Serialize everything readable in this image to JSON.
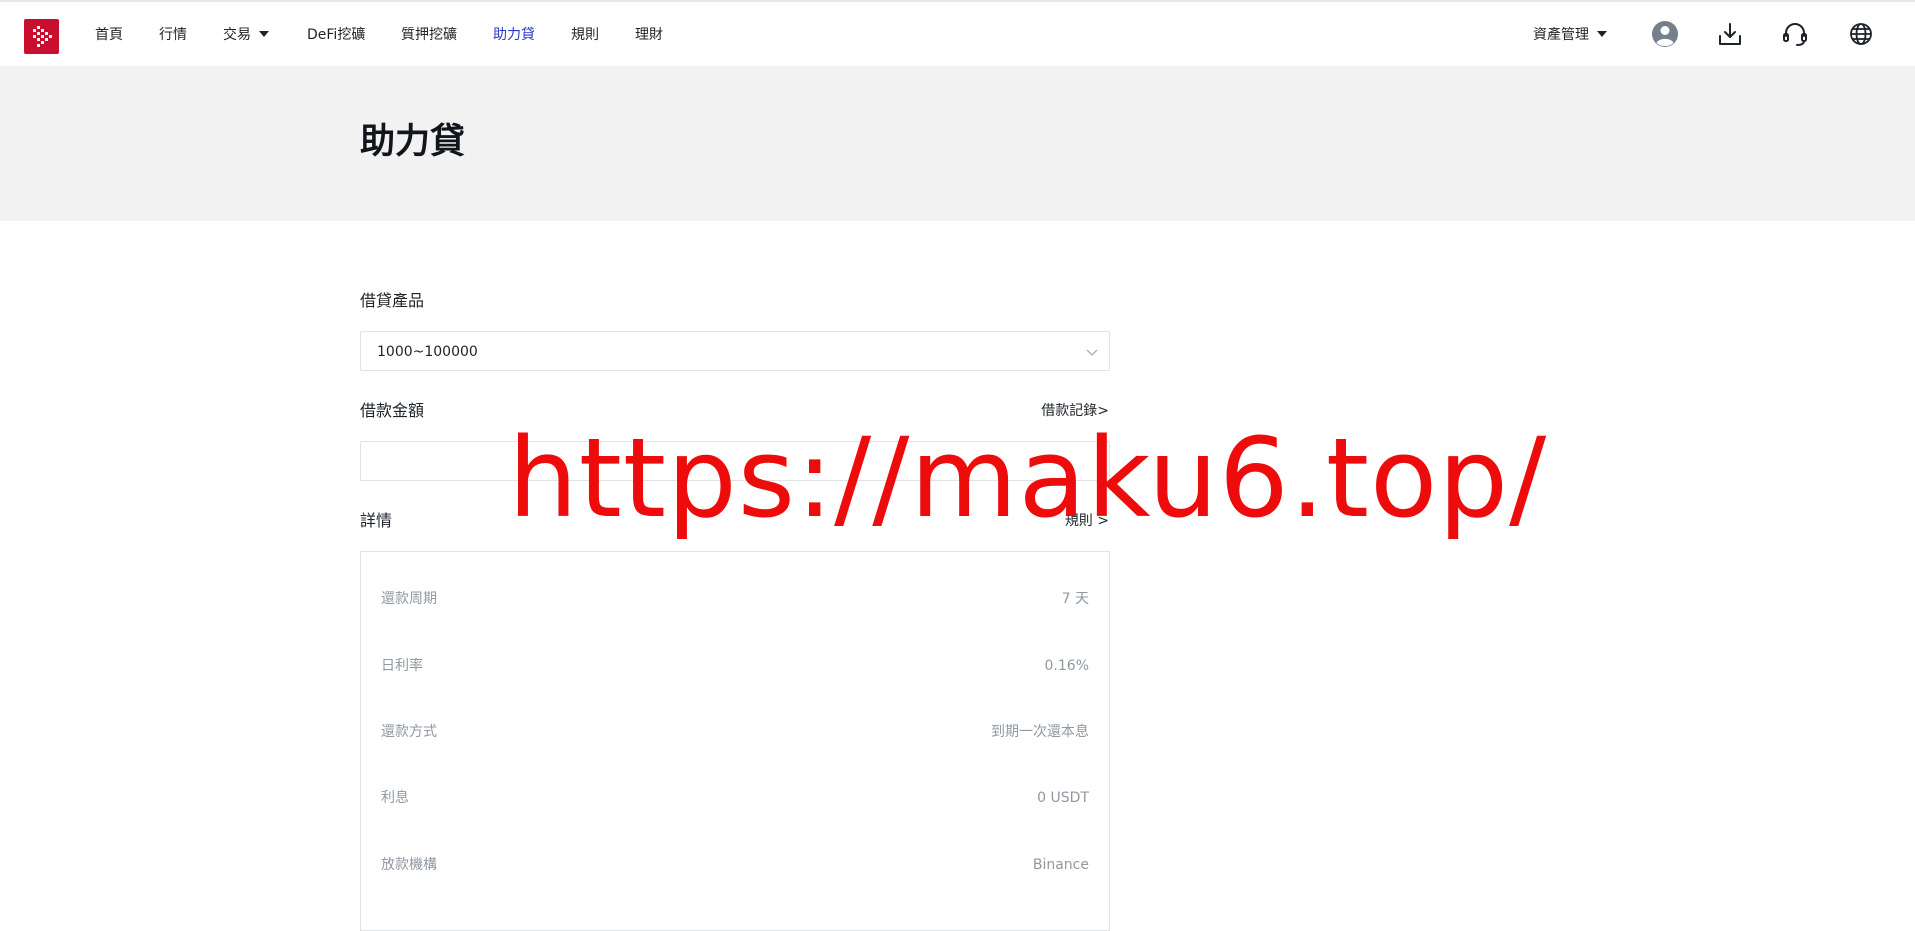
{
  "nav": {
    "items": [
      {
        "label": "首頁"
      },
      {
        "label": "行情"
      },
      {
        "label": "交易"
      },
      {
        "label": "DeFi挖礦"
      },
      {
        "label": "質押挖礦"
      },
      {
        "label": "助力貸"
      },
      {
        "label": "規則"
      },
      {
        "label": "理財"
      }
    ],
    "active_index": 5,
    "asset_menu_label": "資產管理",
    "icons": [
      "user-avatar-icon",
      "download-icon",
      "headset-icon",
      "globe-icon"
    ]
  },
  "page": {
    "title": "助力貸"
  },
  "form": {
    "product_label": "借貸產品",
    "product_value": "1000~100000",
    "amount_label": "借款金額",
    "amount_value": "",
    "history_link": "借款記錄>",
    "details_label": "詳情",
    "rules_link": "規則 >",
    "details": [
      {
        "key": "還款周期",
        "value": "7 天"
      },
      {
        "key": "日利率",
        "value": "0.16%"
      },
      {
        "key": "還款方式",
        "value": "到期一次還本息"
      },
      {
        "key": "利息",
        "value": "0 USDT"
      },
      {
        "key": "放款機構",
        "value": "Binance"
      }
    ]
  },
  "watermark": "https://maku6.top/",
  "colors": {
    "brand": "#c8102e",
    "active_nav": "#2b39c7",
    "hero_bg": "#f2f2f2",
    "watermark": "#ee0b0b",
    "muted_text": "#9098a2"
  }
}
